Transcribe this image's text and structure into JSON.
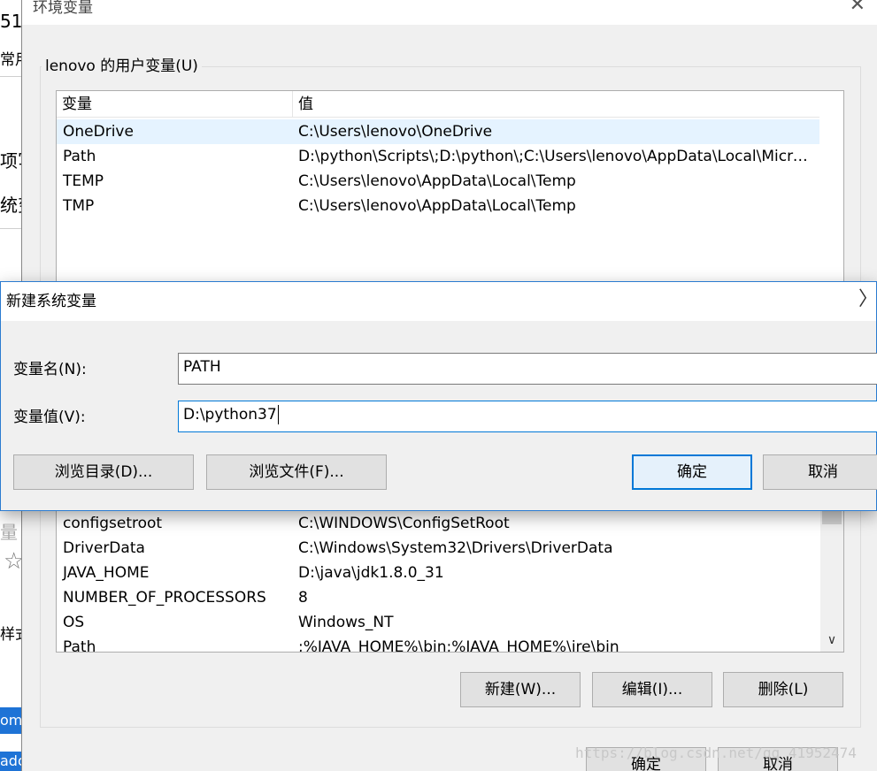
{
  "background_window": {
    "fragments": [
      "51",
      "常用",
      "项写",
      "统变",
      "量",
      "样式"
    ],
    "link_text": "om/",
    "link_text2": "ado",
    "star_icon": "star-icon"
  },
  "env_window": {
    "title": "环境变量",
    "user_group_label": "lenovo 的用户变量(U)",
    "user_list": {
      "columns": [
        "变量",
        "值"
      ],
      "rows": [
        {
          "name": "OneDrive",
          "value": "C:\\Users\\lenovo\\OneDrive"
        },
        {
          "name": "Path",
          "value": "D:\\python\\Scripts\\;D:\\python\\;C:\\Users\\lenovo\\AppData\\Local\\Microsoft\\WindowsApps;"
        },
        {
          "name": "TEMP",
          "value": "C:\\Users\\lenovo\\AppData\\Local\\Temp"
        },
        {
          "name": "TMP",
          "value": "C:\\Users\\lenovo\\AppData\\Local\\Temp"
        }
      ]
    },
    "system_list": {
      "rows": [
        {
          "name": "configsetroot",
          "value": "C:\\WINDOWS\\ConfigSetRoot"
        },
        {
          "name": "DriverData",
          "value": "C:\\Windows\\System32\\Drivers\\DriverData"
        },
        {
          "name": "JAVA_HOME",
          "value": "D:\\java\\jdk1.8.0_31"
        },
        {
          "name": "NUMBER_OF_PROCESSORS",
          "value": "8"
        },
        {
          "name": "OS",
          "value": "Windows_NT"
        },
        {
          "name": "Path",
          "value": ";%JAVA_HOME%\\bin;%JAVA_HOME%\\jre\\bin"
        }
      ]
    },
    "buttons": {
      "new": "新建(W)...",
      "edit": "编辑(I)...",
      "delete": "删除(L)",
      "ok": "确定",
      "cancel": "取消"
    }
  },
  "dialog": {
    "title": "新建系统变量",
    "name_label": "变量名(N):",
    "name_value": "PATH",
    "value_label": "变量值(V):",
    "value_value": "D:\\python37",
    "browse_dir": "浏览目录(D)...",
    "browse_file": "浏览文件(F)...",
    "ok": "确定",
    "cancel": "取消"
  },
  "watermark": "https://blog.csdn.net/qq_41952474",
  "colors": {
    "accent": "#0078d7",
    "selected_row": "#e5f3ff",
    "link_bg": "#1e73d6"
  }
}
